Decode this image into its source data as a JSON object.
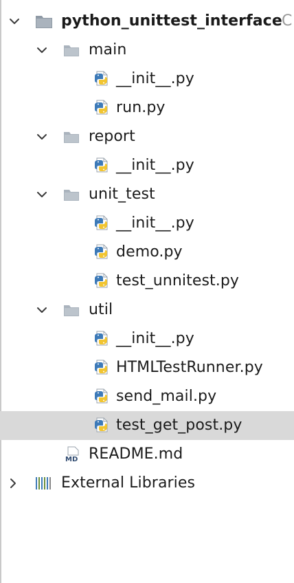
{
  "tree": {
    "root": {
      "name": "python_unittest_interface",
      "path_suffix": "C"
    },
    "folders": [
      {
        "name": "main",
        "files": [
          "__init__.py",
          "run.py"
        ]
      },
      {
        "name": "report",
        "files": [
          "__init__.py"
        ]
      },
      {
        "name": "unit_test",
        "files": [
          "__init__.py",
          "demo.py",
          "test_unnitest.py"
        ]
      },
      {
        "name": "util",
        "files": [
          "__init__.py",
          "HTMLTestRunner.py",
          "send_mail.py",
          "test_get_post.py"
        ]
      }
    ],
    "readme": "README.md",
    "readme_badge": "MD",
    "external_libraries": "External Libraries",
    "selected_file": "test_get_post.py"
  },
  "colors": {
    "folder": "#aab3bd",
    "python_blue": "#3d7ab8",
    "python_yellow": "#f2c530",
    "selection": "#d9d9d9",
    "text": "#1a1a1a"
  },
  "icons": {
    "expanded": "chevron-down-icon",
    "collapsed": "chevron-right-icon",
    "folder": "folder-icon",
    "python": "python-file-icon",
    "markdown": "markdown-file-icon",
    "libraries": "library-icon"
  }
}
